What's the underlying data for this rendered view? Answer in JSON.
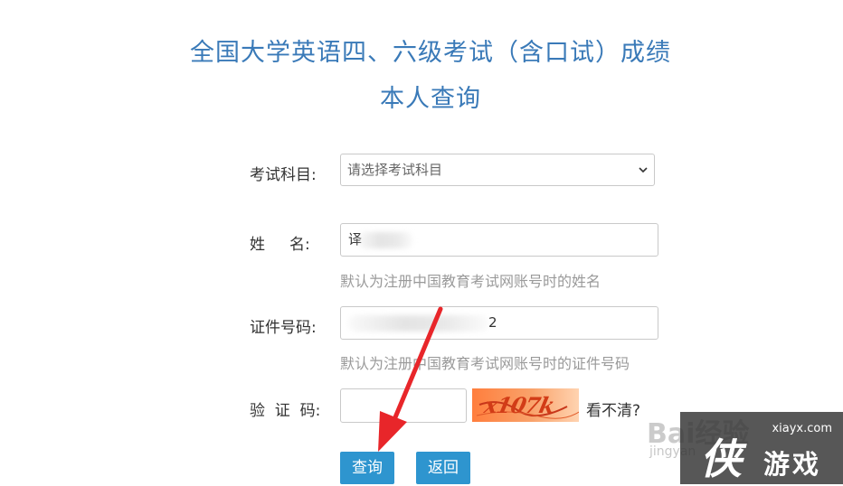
{
  "header": {
    "title_line1": "全国大学英语四、六级考试（含口试）成绩",
    "title_line2": "本人查询"
  },
  "form": {
    "subject_label": "考试科目:",
    "subject_placeholder": "请选择考试科目",
    "name_label": "姓     名:",
    "name_value_visible": "译",
    "name_hint": "默认为注册中国教育考试网账号时的姓名",
    "id_label": "证件号码:",
    "id_value_visible": "2",
    "id_hint": "默认为注册中国教育考试网账号时的证件号码",
    "captcha_label": "验  证  码:",
    "captcha_text": "x107k",
    "captcha_refresh": "看不清?",
    "query_button": "查询",
    "back_button": "返回"
  },
  "watermarks": {
    "baidu_main": "Bai经验",
    "baidu_sub": "jingyan",
    "site_domain": "xiayx.com",
    "site_big": "侠",
    "site_small": "游戏"
  },
  "colors": {
    "title": "#3a7ab8",
    "button": "#2e95cf",
    "hint": "#9a9a9a",
    "arrow": "#e8262a"
  }
}
